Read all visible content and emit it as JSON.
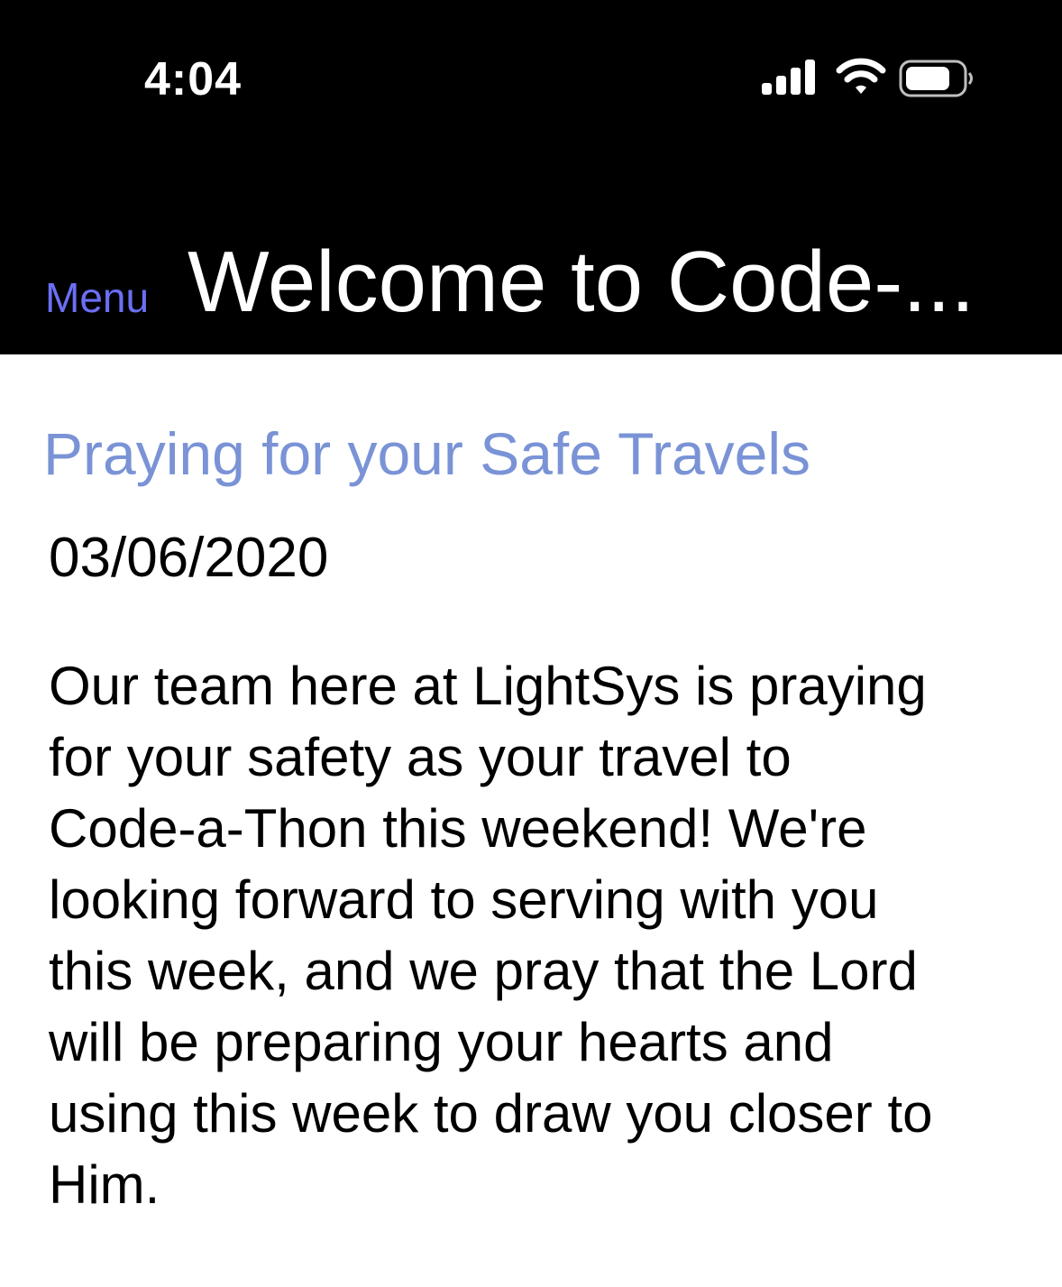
{
  "status_bar": {
    "time": "4:04",
    "icons": [
      "cellular-signal-icon",
      "wifi-icon",
      "battery-icon"
    ]
  },
  "nav": {
    "menu_label": "Menu",
    "title": "Welcome to Code-...",
    "menu_color": "#6b6ff5"
  },
  "article": {
    "title": "Praying for your Safe Travels",
    "date": "03/06/2020",
    "body": "Our team here at LightSys is praying\nfor your safety as your travel to\nCode-a-Thon this weekend!  We're\nlooking forward to serving with you\nthis week, and we pray that the Lord\nwill be preparing your hearts and\nusing this week to draw you closer to\nHim.",
    "title_color": "#7a93d6"
  }
}
